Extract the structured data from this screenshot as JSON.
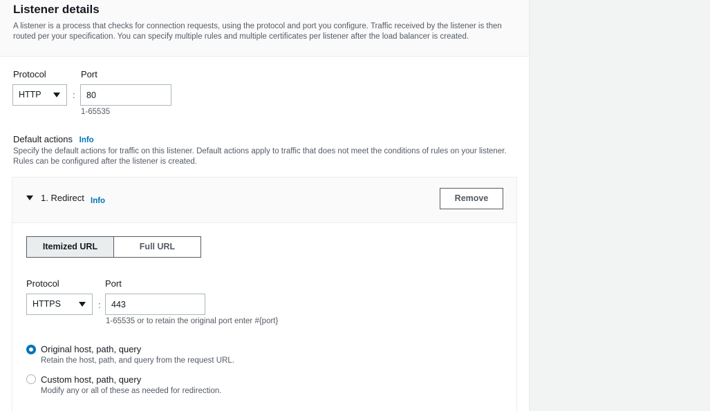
{
  "listener": {
    "title": "Listener details",
    "description": "A listener is a process that checks for connection requests, using the protocol and port you configure. Traffic received by the listener is then routed per your specification. You can specify multiple rules and multiple certificates per listener after the load balancer is created.",
    "protocol_label": "Protocol",
    "protocol_value": "HTTP",
    "port_label": "Port",
    "port_value": "80",
    "port_hint": "1-65535",
    "separator": ":"
  },
  "default_actions": {
    "label": "Default actions",
    "info": "Info",
    "description": "Specify the default actions for traffic on this listener. Default actions apply to traffic that does not meet the conditions of rules on your listener. Rules can be configured after the listener is created."
  },
  "redirect": {
    "title": "1. Redirect",
    "info": "Info",
    "remove_label": "Remove",
    "url_modes": [
      "Itemized URL",
      "Full URL"
    ],
    "selected_mode": "Itemized URL",
    "protocol_label": "Protocol",
    "protocol_value": "HTTPS",
    "port_label": "Port",
    "port_value": "443",
    "port_hint": "1-65535 or to retain the original port enter #{port}",
    "separator": ":",
    "options": [
      {
        "label": "Original host, path, query",
        "description": "Retain the host, path, and query from the request URL.",
        "checked": true
      },
      {
        "label": "Custom host, path, query",
        "description": "Modify any or all of these as needed for redirection.",
        "checked": false
      }
    ]
  },
  "colors": {
    "link": "#0073bb",
    "radio_selected": "#0073bb",
    "border": "#aab7b8",
    "panel_bg": "#fafafa",
    "page_bg": "#f2f3f3"
  }
}
